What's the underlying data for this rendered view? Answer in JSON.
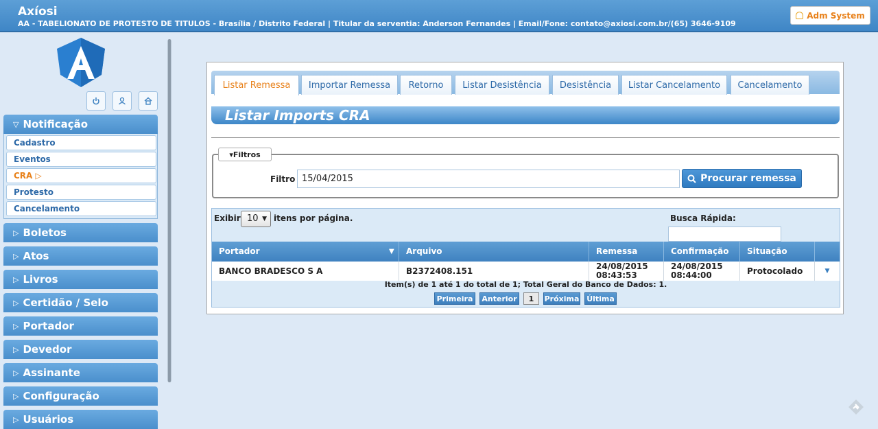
{
  "header": {
    "title": "Axíosi",
    "subtitle": "AA - TABELIONATO DE PROTESTO DE TITULOS - Brasília / Distrito Federal | Titular da serventia: Anderson Fernandes | Email/Fone: contato@axiosi.com.br/(65) 3646-9109",
    "user_button": "Adm System"
  },
  "sidebar": {
    "menus": [
      {
        "label": "Notificação",
        "expanded": true
      },
      {
        "label": "Boletos"
      },
      {
        "label": "Atos"
      },
      {
        "label": "Livros"
      },
      {
        "label": "Certidão / Selo"
      },
      {
        "label": "Portador"
      },
      {
        "label": "Devedor"
      },
      {
        "label": "Assinante"
      },
      {
        "label": "Configuração"
      },
      {
        "label": "Usuários"
      }
    ],
    "submenu": [
      {
        "label": "Cadastro"
      },
      {
        "label": "Eventos"
      },
      {
        "label": "CRA ▷",
        "active": true
      },
      {
        "label": "Protesto"
      },
      {
        "label": "Cancelamento"
      }
    ],
    "icons": [
      "power-icon",
      "user-icon",
      "home-icon"
    ]
  },
  "tabs": [
    {
      "label": "Listar Remessa",
      "active": true
    },
    {
      "label": "Importar Remessa"
    },
    {
      "label": "Retorno"
    },
    {
      "label": "Listar Desistência"
    },
    {
      "label": "Desistência"
    },
    {
      "label": "Listar Cancelamento"
    },
    {
      "label": "Cancelamento"
    }
  ],
  "page_title": "Listar Imports CRA",
  "filters": {
    "legend": "▾Filtros",
    "filter_label": "Filtro",
    "filter_value": "15/04/2015",
    "search_button": "Procurar remessa"
  },
  "grid": {
    "show_prefix": "Exibir",
    "page_size": "10",
    "show_suffix": "itens por página.",
    "quick_search_label": "Busca Rápida:",
    "quick_search_value": "",
    "columns": [
      "Portador",
      "Arquivo",
      "Remessa",
      "Confirmação",
      "Situação"
    ],
    "rows": [
      {
        "portador": "BANCO BRADESCO S A",
        "arquivo": "B2372408.151",
        "remessa_date": "24/08/2015",
        "remessa_time": "08:43:53",
        "confirmacao_date": "24/08/2015",
        "confirmacao_time": "08:44:00",
        "situacao": "Protocolado"
      }
    ],
    "pager_info": "Item(s) de 1 até 1 do total de 1; Total Geral do Banco de Dados: 1.",
    "pager": {
      "first": "Primeira",
      "prev": "Anterior",
      "current": "1",
      "next": "Próxima",
      "last": "Última"
    }
  },
  "colors": {
    "accent": "#e8811a",
    "primary": "#3f86c6"
  }
}
